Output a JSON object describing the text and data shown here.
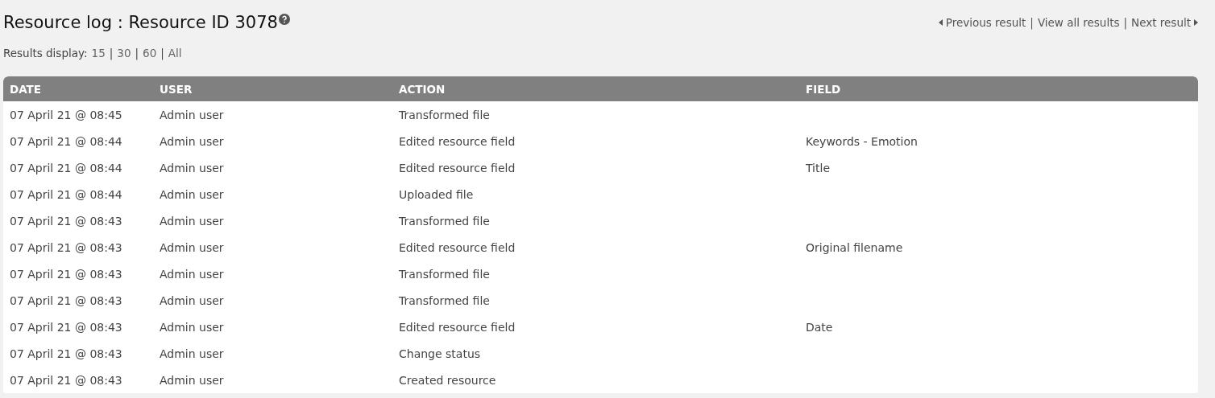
{
  "title": "Resource log : Resource ID 3078",
  "nav": [
    {
      "kind": "prev",
      "label": "Previous result",
      "after": "|"
    },
    {
      "kind": "plain",
      "label": "View all results",
      "after": "|"
    },
    {
      "kind": "next",
      "label": "Next result"
    }
  ],
  "results_display": {
    "label": "Results display:",
    "options": [
      {
        "label": "15",
        "after": "|"
      },
      {
        "label": "30",
        "after": "|"
      },
      {
        "label": "60",
        "after": "|"
      },
      {
        "label": "All"
      }
    ]
  },
  "table": {
    "columns": [
      "DATE",
      "USER",
      "ACTION",
      "FIELD"
    ],
    "rows": [
      [
        "07 April 21 @ 08:45",
        "Admin user",
        "Transformed file",
        ""
      ],
      [
        "07 April 21 @ 08:44",
        "Admin user",
        "Edited resource field",
        "Keywords - Emotion"
      ],
      [
        "07 April 21 @ 08:44",
        "Admin user",
        "Edited resource field",
        "Title"
      ],
      [
        "07 April 21 @ 08:44",
        "Admin user",
        "Uploaded file",
        ""
      ],
      [
        "07 April 21 @ 08:43",
        "Admin user",
        "Transformed file",
        ""
      ],
      [
        "07 April 21 @ 08:43",
        "Admin user",
        "Edited resource field",
        "Original filename"
      ],
      [
        "07 April 21 @ 08:43",
        "Admin user",
        "Transformed file",
        ""
      ],
      [
        "07 April 21 @ 08:43",
        "Admin user",
        "Transformed file",
        ""
      ],
      [
        "07 April 21 @ 08:43",
        "Admin user",
        "Edited resource field",
        "Date"
      ],
      [
        "07 April 21 @ 08:43",
        "Admin user",
        "Change status",
        ""
      ],
      [
        "07 April 21 @ 08:43",
        "Admin user",
        "Created resource",
        ""
      ]
    ]
  }
}
